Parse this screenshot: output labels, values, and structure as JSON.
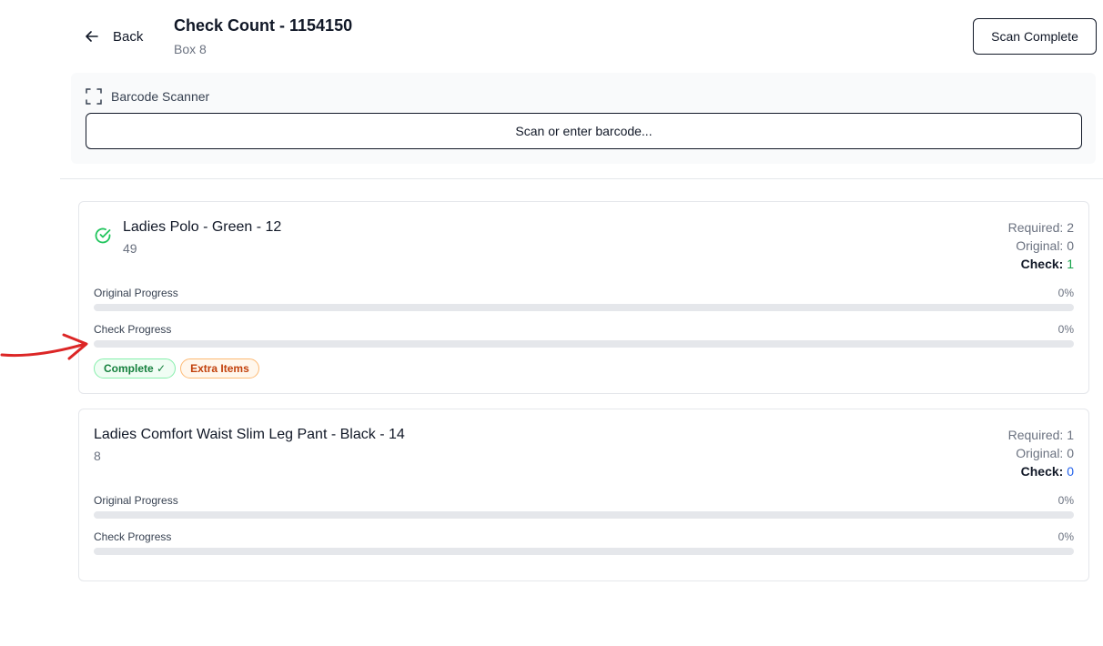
{
  "header": {
    "back_label": "Back",
    "title": "Check Count - 1154150",
    "subtitle": "Box 8",
    "scan_complete_label": "Scan Complete"
  },
  "scanner": {
    "label": "Barcode Scanner",
    "placeholder": "Scan or enter barcode..."
  },
  "items": [
    {
      "name": "Ladies Polo - Green - 12",
      "sub": "49",
      "status_icon": "check-circle-icon",
      "required_label": "Required: 2",
      "original_label": "Original: 0",
      "check_label": "Check:",
      "check_value": "1",
      "check_value_color": "#16a34a",
      "original_progress_label": "Original Progress",
      "original_progress_pct": "0%",
      "original_progress": 0,
      "check_progress_label": "Check Progress",
      "check_progress_pct": "0%",
      "check_progress": 0,
      "badges": [
        "Complete ✓",
        "Extra Items"
      ]
    },
    {
      "name": "Ladies Comfort Waist Slim Leg Pant - Black - 14",
      "sub": "8",
      "required_label": "Required: 1",
      "original_label": "Original: 0",
      "check_label": "Check:",
      "check_value": "0",
      "check_value_color": "#2563eb",
      "original_progress_label": "Original Progress",
      "original_progress_pct": "0%",
      "original_progress": 0,
      "check_progress_label": "Check Progress",
      "check_progress_pct": "0%",
      "check_progress": 0
    }
  ],
  "colors": {
    "annotation": "#dc2626",
    "success": "#22c55e",
    "accent_blue": "#2563eb"
  }
}
